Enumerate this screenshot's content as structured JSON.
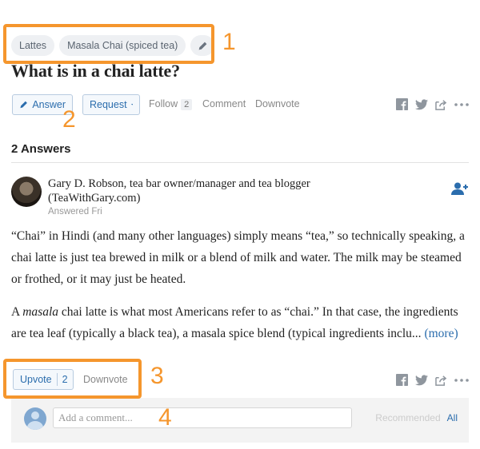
{
  "topics": [
    "Lattes",
    "Masala Chai (spiced tea)"
  ],
  "question": {
    "title": "What is in a chai latte?"
  },
  "actions": {
    "answer_label": "Answer",
    "request_label": "Request",
    "follow_label": "Follow",
    "follow_count": "2",
    "comment_label": "Comment",
    "downvote_label": "Downvote"
  },
  "answers_header": "2 Answers",
  "answer": {
    "author": "Gary D. Robson, tea bar owner/manager and tea blogger (TeaWithGary.com)",
    "answered": "Answered Fri",
    "para1": "“Chai” in Hindi (and many other languages) simply means “tea,” so technically speaking, a chai latte is just tea brewed in milk or a blend of milk and water. The milk may be steamed or frothed, or it may just be heated.",
    "para2_pre": "A ",
    "para2_italic": "masala",
    "para2_post": " chai latte is what most Americans refer to as “chai.” In that case, the ingredients are tea leaf (typically a black tea), a masala spice blend (typical ingredients inclu... ",
    "more_label": "(more)"
  },
  "votes": {
    "upvote_label": "Upvote",
    "upvote_count": "2",
    "downvote_label": "Downvote"
  },
  "comments": {
    "placeholder": "Add a comment...",
    "recommended_label": "Recommended",
    "all_label": "All"
  },
  "callouts": [
    "1",
    "2",
    "3",
    "4"
  ],
  "colors": {
    "accent": "#2b6dad",
    "callout": "#f5962d",
    "muted": "#888888"
  },
  "icons": [
    "pencil-icon",
    "caret-down-icon",
    "facebook-icon",
    "twitter-icon",
    "share-icon",
    "more-icon",
    "follow-user-icon"
  ]
}
